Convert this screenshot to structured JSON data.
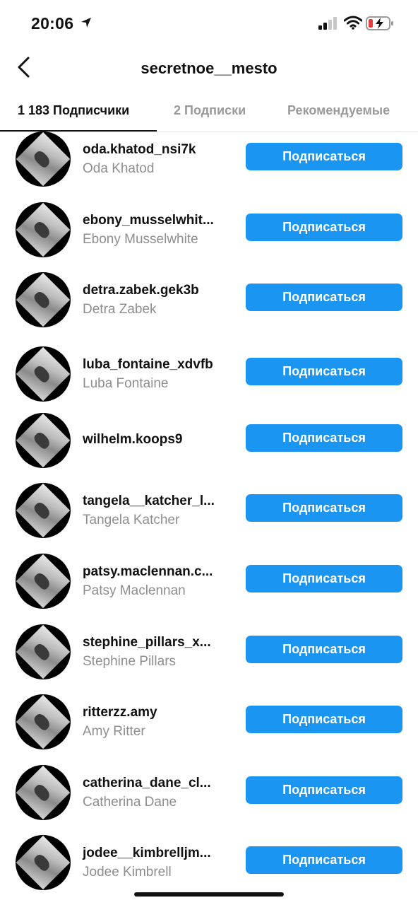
{
  "status_bar": {
    "time": "20:06",
    "icons": [
      "location-arrow-icon",
      "cellular-signal-icon",
      "wifi-icon",
      "battery-charging-icon"
    ],
    "battery_color": "#e5413a"
  },
  "header": {
    "back_icon": "chevron-left-icon",
    "title": "secretnoe__mesto"
  },
  "tabs": [
    {
      "label": "1 183 Подписчики",
      "active": true
    },
    {
      "label": "2 Подписки",
      "active": false
    },
    {
      "label": "Рекомендуемые",
      "active": false
    }
  ],
  "accent_color": "#1a95f2",
  "followers": [
    {
      "username": "oda.khatod_nsi7k",
      "name": "Oda Khatod",
      "button": "Подписаться"
    },
    {
      "username": "ebony_musselwhit...",
      "name": "Ebony Musselwhite",
      "button": "Подписаться"
    },
    {
      "username": "detra.zabek.gek3b",
      "name": "Detra Zabek",
      "button": "Подписаться"
    },
    {
      "username": "luba_fontaine_xdvfb",
      "name": "Luba Fontaine",
      "button": "Подписаться"
    },
    {
      "username": "wilhelm.koops9",
      "name": "",
      "button": "Подписаться"
    },
    {
      "username": "tangela__katcher_l...",
      "name": "Tangela Katcher",
      "button": "Подписаться"
    },
    {
      "username": "patsy.maclennan.c...",
      "name": "Patsy Maclennan",
      "button": "Подписаться"
    },
    {
      "username": "stephine_pillars_x...",
      "name": "Stephine Pillars",
      "button": "Подписаться"
    },
    {
      "username": "ritterzz.amy",
      "name": "Amy Ritter",
      "button": "Подписаться"
    },
    {
      "username": "catherina_dane_cl...",
      "name": "Catherina Dane",
      "button": "Подписаться"
    },
    {
      "username": "jodee__kimbrelljm...",
      "name": "Jodee Kimbrell",
      "button": "Подписаться"
    }
  ]
}
